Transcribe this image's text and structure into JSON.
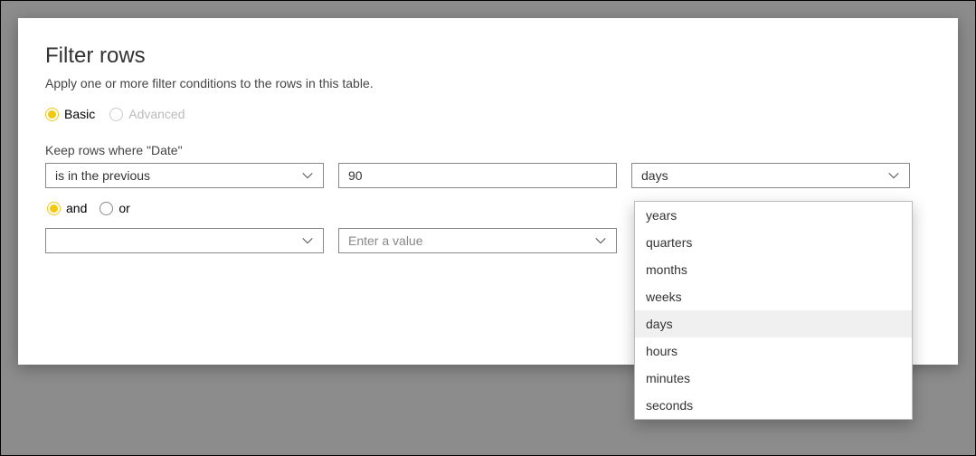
{
  "dialog": {
    "title": "Filter rows",
    "subtitle": "Apply one or more filter conditions to the rows in this table."
  },
  "mode": {
    "basic": "Basic",
    "advanced": "Advanced"
  },
  "keepLabel": "Keep rows where \"Date\"",
  "row1": {
    "operator": "is in the previous",
    "value": "90",
    "unit": "days"
  },
  "logical": {
    "and": "and",
    "or": "or"
  },
  "row2": {
    "operator": "",
    "valuePlaceholder": "Enter a value",
    "unit": ""
  },
  "unitOptions": [
    {
      "label": "years",
      "highlighted": false
    },
    {
      "label": "quarters",
      "highlighted": false
    },
    {
      "label": "months",
      "highlighted": false
    },
    {
      "label": "weeks",
      "highlighted": false
    },
    {
      "label": "days",
      "highlighted": true
    },
    {
      "label": "hours",
      "highlighted": false
    },
    {
      "label": "minutes",
      "highlighted": false
    },
    {
      "label": "seconds",
      "highlighted": false
    }
  ]
}
